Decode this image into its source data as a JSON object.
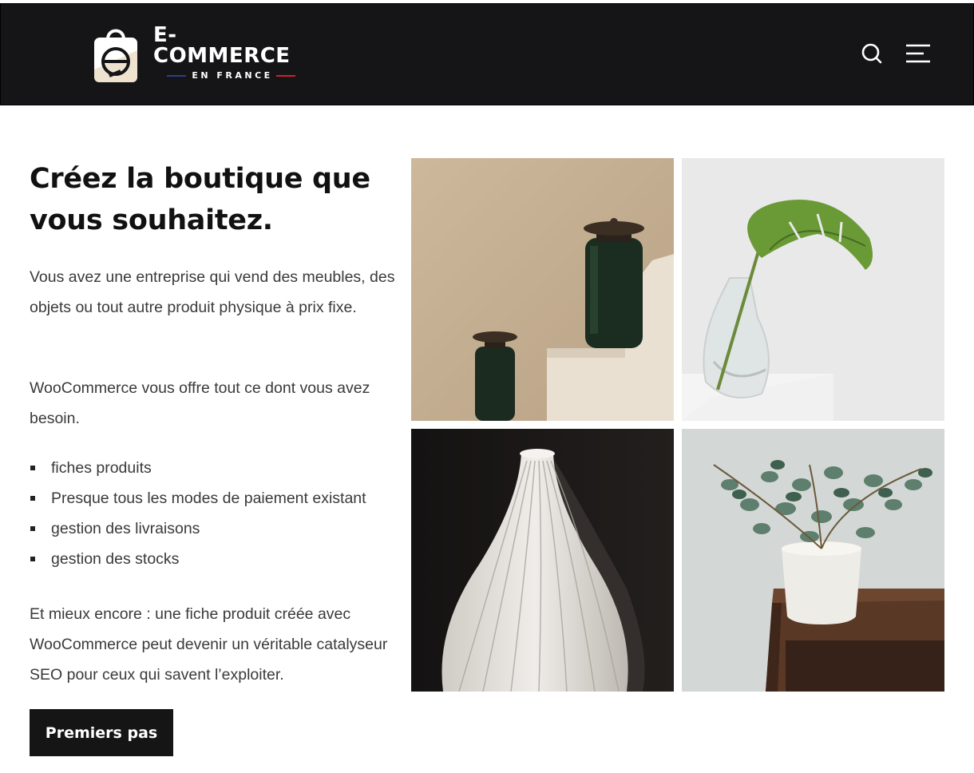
{
  "header": {
    "logo_title": "E-COMMERCE",
    "logo_subtitle": "EN FRANCE",
    "search_icon": "search-icon",
    "menu_icon": "hamburger-menu-icon"
  },
  "hero": {
    "headline": "Créez la boutique que vous souhaitez.",
    "paragraph_1": "Vous avez une entreprise qui vend des meubles, des objets ou tout autre produit physique à prix fixe.",
    "paragraph_2": "WooCommerce vous offre tout ce dont vous avez besoin.",
    "features": [
      "fiches produits",
      "Presque tous les modes de paiement existant",
      "gestion des livraisons",
      "gestion des stocks"
    ],
    "paragraph_3": "Et mieux encore : une fiche produit créée avec WooCommerce peut devenir un véritable catalyseur SEO pour ceux qui savent l’exploiter.",
    "cta_label": "Premiers pas"
  },
  "gallery": {
    "images": [
      "green-glass-jars-on-steps",
      "monstera-leaf-in-glass-vase",
      "white-ribbed-vase",
      "eucalyptus-in-white-pot"
    ]
  },
  "colors": {
    "header_bg": "#151517",
    "button_bg": "#151515",
    "flag_blue": "#2c3e8c",
    "flag_red": "#d0222b"
  }
}
